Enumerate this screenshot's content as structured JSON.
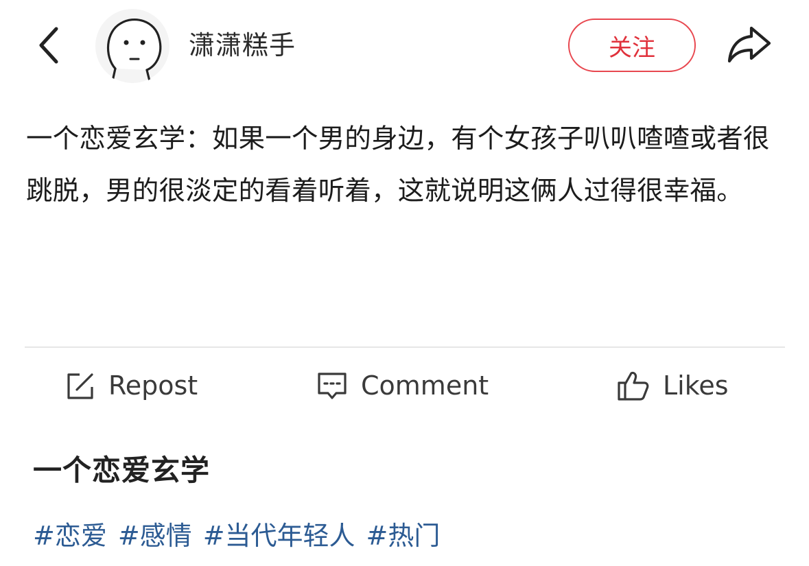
{
  "header": {
    "username": "潇潇糕手",
    "follow_label": "关注"
  },
  "post": {
    "text": "一个恋爱玄学：如果一个男的身边，有个女孩子叭叭喳喳或者很跳脱，男的很淡定的看着听着，这就说明这俩人过得很幸福。"
  },
  "actions": {
    "repost_label": "Repost",
    "comment_label": "Comment",
    "likes_label": "Likes"
  },
  "topic": {
    "title": "一个恋爱玄学",
    "tags": [
      "#恋爱",
      "#感情",
      "#当代年轻人",
      "#热门"
    ]
  },
  "colors": {
    "follow_accent": "#e0313b",
    "tag_color": "#2c5b93"
  },
  "icons": {
    "back": "chevron-left-icon",
    "avatar": "smiley-face-avatar",
    "share": "share-arrow-icon",
    "repost": "edit-square-icon",
    "comment": "comment-bubble-icon",
    "likes": "thumbs-up-icon"
  }
}
